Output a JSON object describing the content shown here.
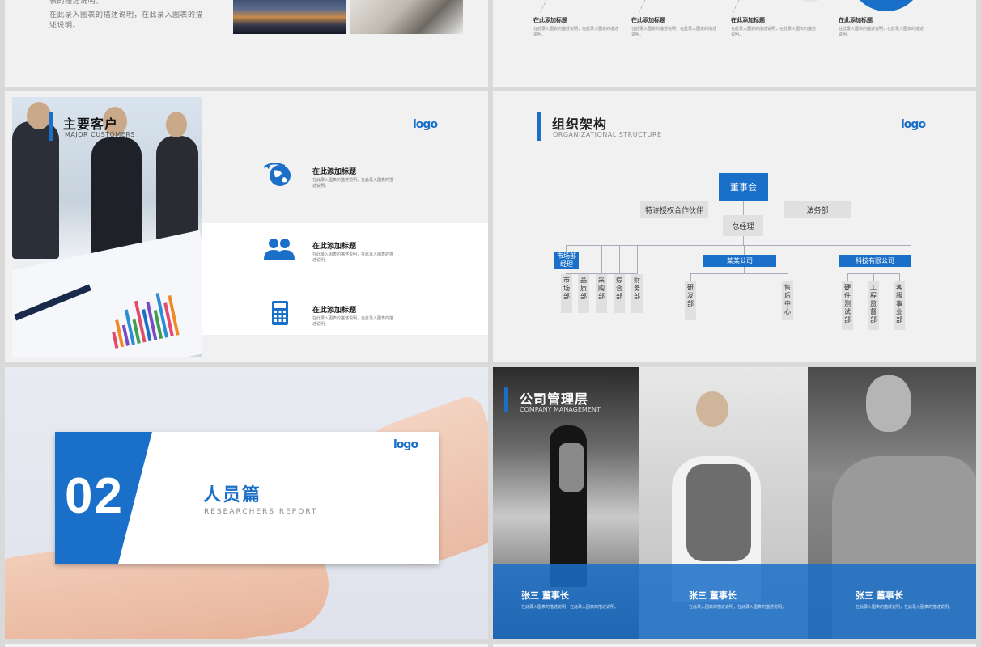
{
  "slide1": {
    "text_line1": "表的描述说明。",
    "text_line2": "在此录入图表的描述说明，在此录入图表的描述说明。"
  },
  "slide2": {
    "items": [
      {
        "title": "在此添加标题",
        "desc": "在此录入图表的描述说明，在此录入图表的描述说明。"
      },
      {
        "title": "在此添加标题",
        "desc": "在此录入图表的描述说明，在此录入图表的描述说明。"
      },
      {
        "title": "在此添加标题",
        "desc": "在此录入图表的描述说明，在此录入图表的描述说明。"
      },
      {
        "title": "在此添加标题",
        "desc": "在此录入图表的描述说明，在此录入图表的描述说明。"
      }
    ]
  },
  "slide3": {
    "title": "主要客户",
    "subtitle": "MAJOR CUSTOMERS",
    "logo": "logo",
    "rows": [
      {
        "title": "在此添加标题",
        "desc": "在此录入图表的描述说明，在此录入图表的描述说明。",
        "icon": "globe-icon"
      },
      {
        "title": "在此添加标题",
        "desc": "在此录入图表的描述说明，在此录入图表的描述说明。",
        "icon": "users-icon"
      },
      {
        "title": "在此添加标题",
        "desc": "在此录入图表的描述说明，在此录入图表的描述说明。",
        "icon": "calculator-icon"
      }
    ]
  },
  "slide4": {
    "title": "组织架构",
    "subtitle": "ORGANIZATIONAL STRUCTURE",
    "logo": "logo",
    "board": "董事会",
    "franchise": "特许授权合作伙伴",
    "legal": "法务部",
    "gm": "总经理",
    "market_dept": "市场部经理",
    "company_a": "某某公司",
    "company_b": "科技有限公司",
    "market_subs": [
      "市场部",
      "品质部",
      "采购部",
      "综合部",
      "财务部"
    ],
    "company_a_subs": [
      "研发部",
      "售后中心"
    ],
    "company_b_subs": [
      "硬件测试部",
      "工程监督部",
      "客服事业部"
    ]
  },
  "slide5": {
    "number": "02",
    "title": "人员篇",
    "subtitle": "RESEARCHERS REPORT",
    "logo": "logo"
  },
  "slide6": {
    "title": "公司管理层",
    "subtitle": "COMPANY MANAGEMENT",
    "people": [
      {
        "name": "张三  董事长",
        "desc": "在此录入图表的描述说明，在此录入图表的描述说明。"
      },
      {
        "name": "张三  董事长",
        "desc": "在此录入图表的描述说明，在此录入图表的描述说明。"
      },
      {
        "name": "张三  董事长",
        "desc": "在此录入图表的描述说明，在此录入图表的描述说明。"
      }
    ]
  },
  "colors": {
    "accent": "#1a6fc8",
    "background": "#d9d9d9",
    "slide": "#f1f1f1"
  }
}
